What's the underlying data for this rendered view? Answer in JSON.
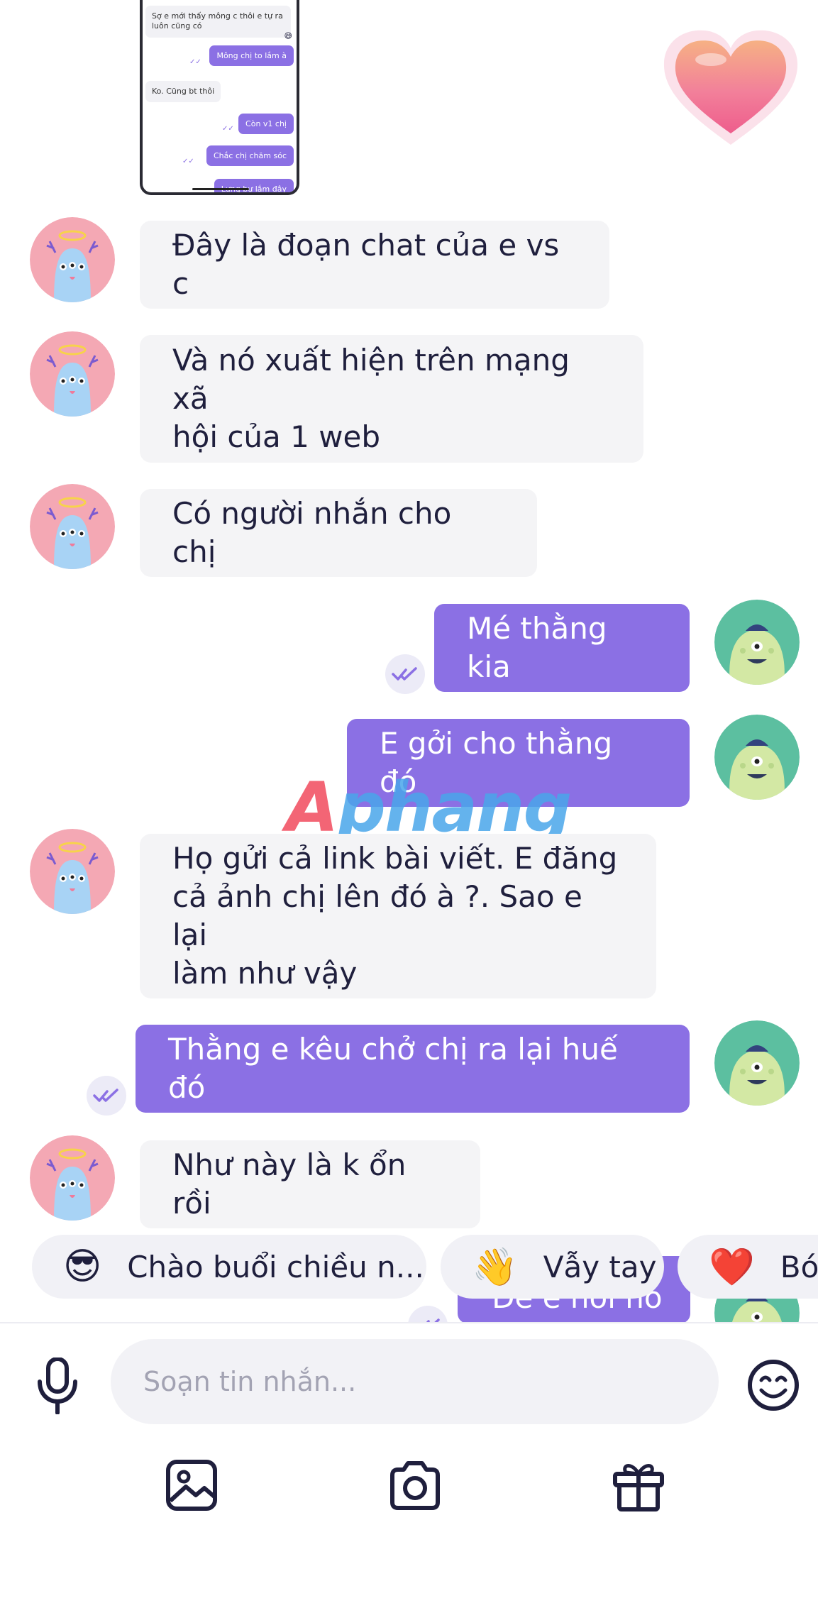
{
  "embedded_screenshot": {
    "messages": [
      {
        "dir": "in",
        "text": "Sợ e mới thấy mông c thôi e tự ra luôn cũng có"
      },
      {
        "dir": "out",
        "text": "Mông chị to lắm à"
      },
      {
        "dir": "in",
        "text": "Ko. Cũng bt thôi"
      },
      {
        "dir": "out",
        "text": "Còn v1 chị"
      },
      {
        "dir": "out",
        "text": "Chắc chị chăm sóc"
      },
      {
        "dir": "out",
        "text": "Lưng bự lắm đây"
      }
    ]
  },
  "chat": {
    "messages": [
      {
        "dir": "in",
        "text": "Đây là đoạn chat của e vs c"
      },
      {
        "dir": "in",
        "line1": "Và nó xuất hiện trên mạng xã",
        "line2": "hội của 1 web"
      },
      {
        "dir": "in",
        "text": "Có người nhắn cho chị"
      },
      {
        "dir": "out",
        "text": "Mé thằng kia"
      },
      {
        "dir": "out",
        "text": "E gởi cho thằng đó"
      },
      {
        "dir": "in",
        "line1": "Họ gửi cả link bài viết. E đăng",
        "line2": "cả ảnh chị lên đó à ?. Sao e lại",
        "line3": "làm như vậy"
      },
      {
        "dir": "out",
        "text": "Thằng e kêu chở chị ra lại huế đó"
      },
      {
        "dir": "in",
        "text": "Như này là k ổn rồi"
      },
      {
        "dir": "out",
        "text": "Để e hỏi nó"
      }
    ]
  },
  "watermark": {
    "part1": "A",
    "part2": "phang"
  },
  "quick_replies": [
    {
      "emoji": "😎",
      "label": "Chào buổi chiều n..."
    },
    {
      "emoji": "👋",
      "label": "Vẫy tay"
    },
    {
      "emoji": "❤️",
      "label": "Bón"
    }
  ],
  "composer": {
    "placeholder": "Soạn tin nhắn...",
    "icons": [
      "microphone-icon",
      "emoji-icon",
      "image-icon",
      "camera-icon",
      "gift-icon"
    ]
  },
  "colors": {
    "accent": "#8b70e4",
    "incoming_bubble": "#f4f4f6",
    "read_receipt": "#8b70e4"
  }
}
